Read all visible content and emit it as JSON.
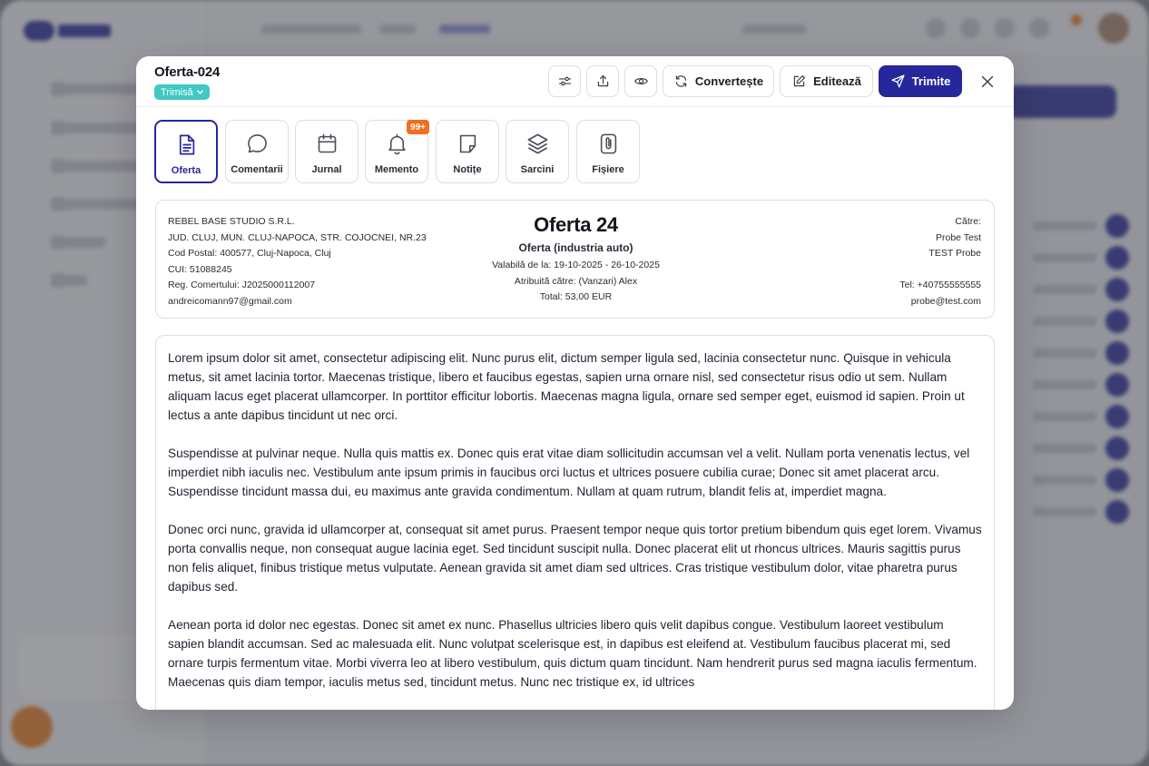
{
  "modal": {
    "title": "Oferta-024",
    "status": "Trimisă",
    "buttons": {
      "convert": "Convertește",
      "edit": "Editează",
      "send": "Trimite"
    }
  },
  "tabs": [
    {
      "label": "Oferta",
      "icon": "document-icon",
      "active": true
    },
    {
      "label": "Comentarii",
      "icon": "chat-bubble-icon"
    },
    {
      "label": "Jurnal",
      "icon": "calendar-icon"
    },
    {
      "label": "Memento",
      "icon": "bell-icon",
      "badge": "99+"
    },
    {
      "label": "Notițe",
      "icon": "note-icon"
    },
    {
      "label": "Sarcini",
      "icon": "layers-icon"
    },
    {
      "label": "Fișiere",
      "icon": "paperclip-icon"
    }
  ],
  "offer": {
    "company": {
      "name": "REBEL BASE STUDIO S.R.L.",
      "address": "JUD. CLUJ, MUN. CLUJ-NAPOCA, STR. COJOCNEI, NR.23",
      "postal": "Cod Postal: 400577, Cluj-Napoca, Cluj",
      "cui": "CUI: 51088245",
      "reg": "Reg. Comertului: J2025000112007",
      "email": "andreicomann97@gmail.com"
    },
    "title": "Oferta 24",
    "subtitle": "Oferta (industria auto)",
    "valid": "Valabilă de la: 19-10-2025 - 26-10-2025",
    "assigned": "Atribuită către: (Vanzari) Alex",
    "total": "Total: 53,00 EUR",
    "recipient": {
      "label": "Către:",
      "name": "Probe Test",
      "company": "TEST Probe",
      "phone": "Tel: +40755555555",
      "email": "probe@test.com"
    }
  },
  "body": {
    "paragraphs": [
      "Lorem ipsum dolor sit amet, consectetur adipiscing elit. Nunc purus elit, dictum semper ligula sed, lacinia consectetur nunc. Quisque in vehicula metus, sit amet lacinia tortor. Maecenas tristique, libero et faucibus egestas, sapien urna ornare nisl, sed consectetur risus odio ut sem. Nullam aliquam lacus eget placerat ullamcorper. In porttitor efficitur lobortis. Maecenas magna ligula, ornare sed semper eget, euismod id sapien. Proin ut lectus a ante dapibus tincidunt ut nec orci.",
      "Suspendisse at pulvinar neque. Nulla quis mattis ex. Donec quis erat vitae diam sollicitudin accumsan vel a velit. Nullam porta venenatis lectus, vel imperdiet nibh iaculis nec. Vestibulum ante ipsum primis in faucibus orci luctus et ultrices posuere cubilia curae; Donec sit amet placerat arcu. Suspendisse tincidunt massa dui, eu maximus ante gravida condimentum. Nullam at quam rutrum, blandit felis at, imperdiet magna.",
      "Donec orci nunc, gravida id ullamcorper at, consequat sit amet purus. Praesent tempor neque quis tortor pretium bibendum quis eget lorem. Vivamus porta convallis neque, non consequat augue lacinia eget. Sed tincidunt suscipit nulla. Donec placerat elit ut rhoncus ultrices. Mauris sagittis purus non felis aliquet, finibus tristique metus vulputate. Aenean gravida sit amet diam sed ultrices. Cras tristique vestibulum dolor, vitae pharetra purus dapibus sed.",
      "Aenean porta id dolor nec egestas. Donec sit amet ex nunc. Phasellus ultricies libero quis velit dapibus congue. Vestibulum laoreet vestibulum sapien blandit accumsan. Sed ac malesuada elit. Nunc volutpat scelerisque est, in dapibus est eleifend at. Vestibulum faucibus placerat mi, sed ornare turpis fermentum vitae. Morbi viverra leo at libero vestibulum, quis dictum quam tincidunt. Nam hendrerit purus sed magna iaculis fermentum. Maecenas quis diam tempor, iaculis metus sed, tincidunt metus. Nunc nec tristique ex, id ultrices"
    ]
  },
  "colors": {
    "primary": "#26279a",
    "status": "#3fc9c2",
    "badge": "#f26d1d"
  }
}
